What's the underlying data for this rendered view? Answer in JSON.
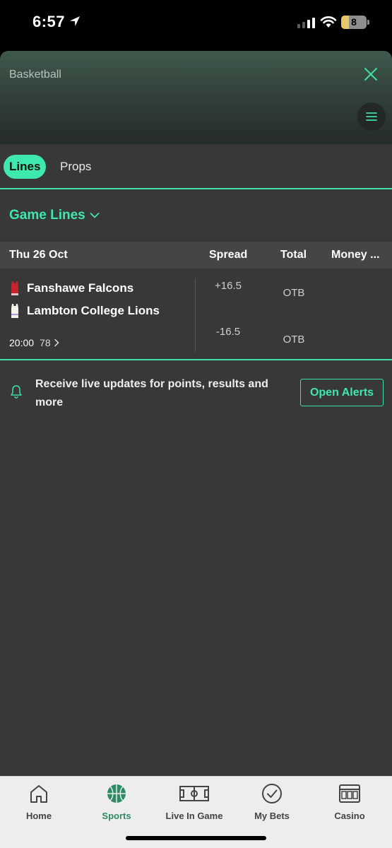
{
  "status_bar": {
    "time": "6:57",
    "battery": "8",
    "battery_level": 0.3
  },
  "header": {
    "title": "Basketball"
  },
  "tabs": [
    {
      "label": "Lines",
      "active": true
    },
    {
      "label": "Props",
      "active": false
    }
  ],
  "section": {
    "title": "Game Lines"
  },
  "table": {
    "date": "Thu 26 Oct",
    "columns": {
      "spread": "Spread",
      "total": "Total",
      "money": "Money ..."
    }
  },
  "event": {
    "team1": {
      "name": "Fanshawe Falcons",
      "spread": "+16.5",
      "total": "OTB"
    },
    "team2": {
      "name": "Lambton College Lions",
      "spread": "-16.5",
      "total": "OTB"
    },
    "time": "20:00",
    "markets_count": "78"
  },
  "alert": {
    "text": "Receive live updates for points, results and more",
    "button": "Open Alerts"
  },
  "bottom_nav": [
    {
      "label": "Home",
      "icon": "home-icon"
    },
    {
      "label": "Sports",
      "icon": "basketball-icon",
      "active": true
    },
    {
      "label": "Live In Game",
      "icon": "field-icon"
    },
    {
      "label": "My Bets",
      "icon": "check-circle-icon"
    },
    {
      "label": "Casino",
      "icon": "slot-machine-icon"
    }
  ],
  "colors": {
    "accent": "#3fe8ad",
    "background": "#383838",
    "nav_active": "#2e8b64"
  }
}
